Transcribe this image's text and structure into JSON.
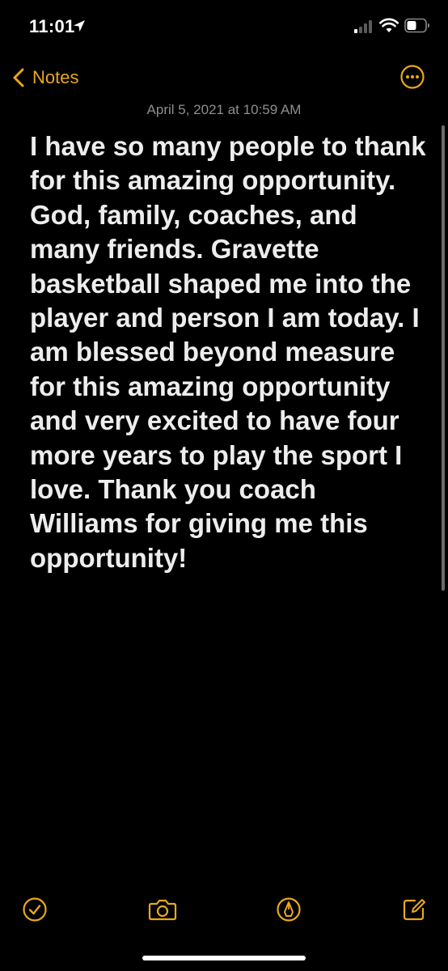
{
  "status_bar": {
    "time": "11:01",
    "icons": [
      "location-arrow-icon",
      "cellular-signal-icon",
      "wifi-icon",
      "battery-icon"
    ]
  },
  "nav": {
    "back_label": "Notes",
    "back_icon": "chevron-left-icon",
    "more_icon": "ellipsis-circle-icon"
  },
  "note": {
    "date": "April 5, 2021 at 10:59 AM",
    "body": "I have so many people to thank for this amazing opportunity. God, family, coaches, and many friends. Gravette basketball shaped me into the player and person I am today. I am blessed beyond measure for this amazing opportunity and very excited to have four more years to play the sport I love. Thank you coach Williams for giving me this opportunity!"
  },
  "toolbar": {
    "items": [
      "checklist-icon",
      "camera-icon",
      "markup-pen-icon",
      "compose-icon"
    ]
  },
  "colors": {
    "background": "#000000",
    "accent": "#e9a81e",
    "body_text": "#ededed",
    "date_text": "#8e8e93"
  }
}
